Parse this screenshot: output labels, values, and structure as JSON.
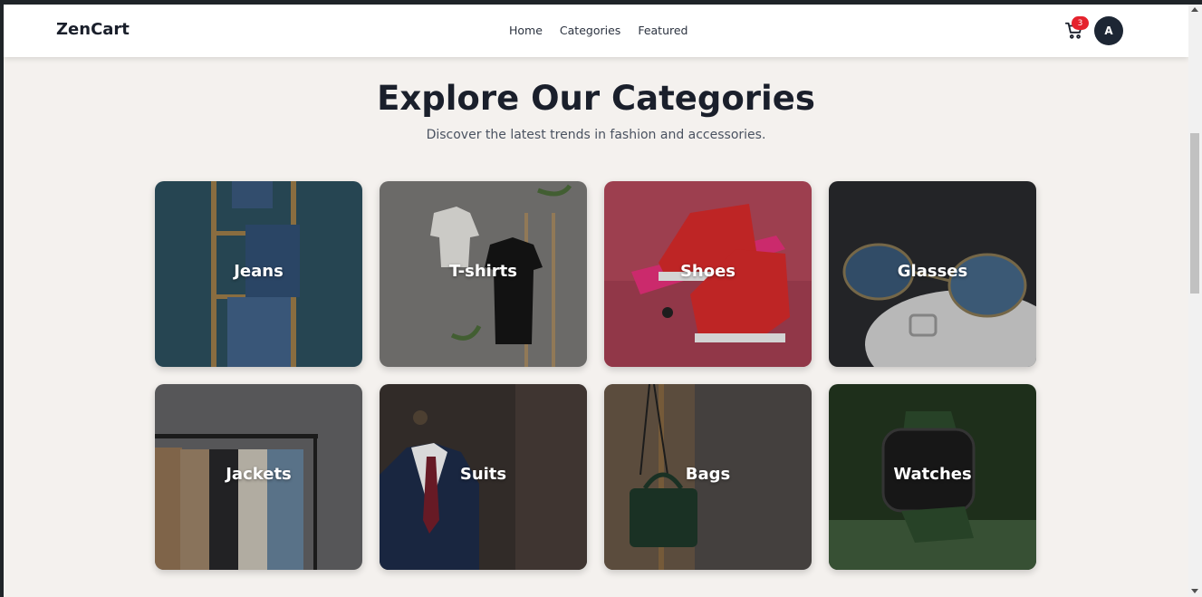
{
  "nav": {
    "brand": "ZenCart",
    "links": [
      "Home",
      "Categories",
      "Featured"
    ],
    "cart_icon": "cart-icon",
    "cart_count": "3",
    "avatar_initial": "A"
  },
  "hero": {
    "title": "Explore Our Categories",
    "subtitle": "Discover the latest trends in fashion and accessories."
  },
  "categories": [
    {
      "label": "Jeans",
      "bg": "#2f5564"
    },
    {
      "label": "T-shirts",
      "bg": "#6d6c6a"
    },
    {
      "label": "Shoes",
      "bg": "#b3485a"
    },
    {
      "label": "Glasses",
      "bg": "#2a2b2e"
    },
    {
      "label": "Jackets",
      "bg": "#5e5e60"
    },
    {
      "label": "Suits",
      "bg": "#2b2f3a"
    },
    {
      "label": "Bags",
      "bg": "#4d4a48"
    },
    {
      "label": "Watches",
      "bg": "#2e4a2a"
    }
  ],
  "colors": {
    "badge": "#e5222d",
    "avatar": "#1d2634",
    "page_bg": "#f4f1ee"
  }
}
